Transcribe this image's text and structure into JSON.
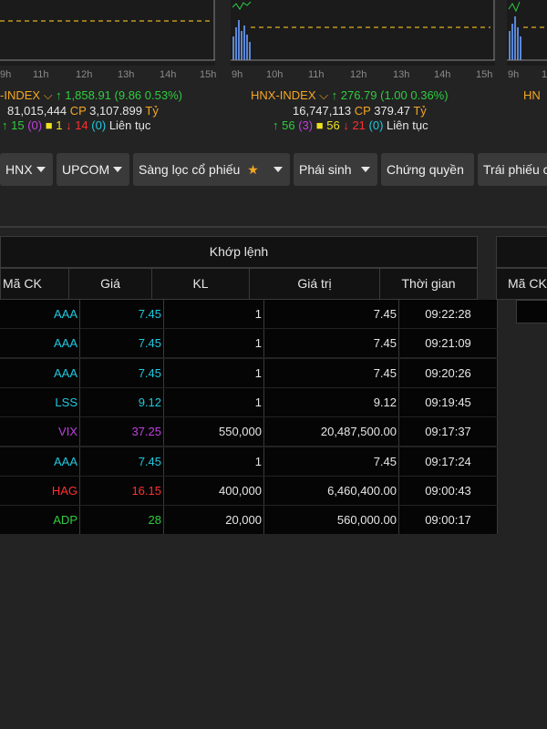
{
  "charts": {
    "vnindex_ticks": [
      "9h",
      "11h",
      "12h",
      "13h",
      "14h",
      "15h"
    ],
    "hnx_ticks": [
      "9h",
      "10h",
      "11h",
      "12h",
      "13h",
      "14h",
      "15h"
    ],
    "upcom_ticks": [
      "9h",
      "10h"
    ]
  },
  "vnindex": {
    "name": "-INDEX",
    "value": "1,858.91",
    "change": "(9.86 0.53%)",
    "volume": "81,015,444",
    "cp_label": "CP",
    "value_traded": "3,107.899",
    "unit": "Tỷ",
    "up": "15",
    "ceiling": "(0)",
    "flat": "1",
    "down": "14",
    "floor": "(0)",
    "status": "Liên tục"
  },
  "hnx": {
    "name": "HNX-INDEX",
    "value": "276.79",
    "change": "(1.00 0.36%)",
    "volume": "16,747,113",
    "cp_label": "CP",
    "value_traded": "379.47",
    "unit": "Tỷ",
    "up": "56",
    "ceiling": "(3)",
    "flat": "56",
    "down": "21",
    "floor": "(0)",
    "status": "Liên tục"
  },
  "upcom": {
    "name": "HN"
  },
  "tabs": [
    {
      "label": "HNX"
    },
    {
      "label": "UPCOM"
    },
    {
      "label": "Sàng lọc cổ phiếu"
    },
    {
      "label": "Phái sinh"
    },
    {
      "label": "Chứng quyền"
    },
    {
      "label": "Trái phiếu c"
    }
  ],
  "table": {
    "title": "Khớp lệnh",
    "columns": [
      "Mã CK",
      "Giá",
      "KL",
      "Giá trị",
      "Thời gian"
    ],
    "rows": [
      {
        "symbol": "AAA",
        "price": "7.45",
        "qty": "1",
        "value": "7.45",
        "time": "09:22:28",
        "color": "#20c8e0"
      },
      {
        "symbol": "AAA",
        "price": "7.45",
        "qty": "1",
        "value": "7.45",
        "time": "09:21:09",
        "color": "#20c8e0"
      },
      {
        "symbol": "AAA",
        "price": "7.45",
        "qty": "1",
        "value": "7.45",
        "time": "09:20:26",
        "color": "#20c8e0"
      },
      {
        "symbol": "LSS",
        "price": "9.12",
        "qty": "1",
        "value": "9.12",
        "time": "09:19:45",
        "color": "#20c8e0"
      },
      {
        "symbol": "VIX",
        "price": "37.25",
        "qty": "550,000",
        "value": "20,487,500.00",
        "time": "09:17:37",
        "color": "#c040e0"
      },
      {
        "symbol": "AAA",
        "price": "7.45",
        "qty": "1",
        "value": "7.45",
        "time": "09:17:24",
        "color": "#20c8e0"
      },
      {
        "symbol": "HAG",
        "price": "16.15",
        "qty": "400,000",
        "value": "6,460,400.00",
        "time": "09:00:43",
        "color": "#ff3030"
      },
      {
        "symbol": "ADP",
        "price": "28",
        "qty": "20,000",
        "value": "560,000.00",
        "time": "09:00:17",
        "color": "#2ecc40"
      }
    ]
  },
  "right_table": {
    "column": "Mã CK"
  },
  "icons": {
    "arrow_up": "arrow-up-icon",
    "arrow_down": "arrow-down-icon",
    "chevron": "chevron-down-icon",
    "star": "star-icon",
    "caret": "caret-down-icon"
  }
}
